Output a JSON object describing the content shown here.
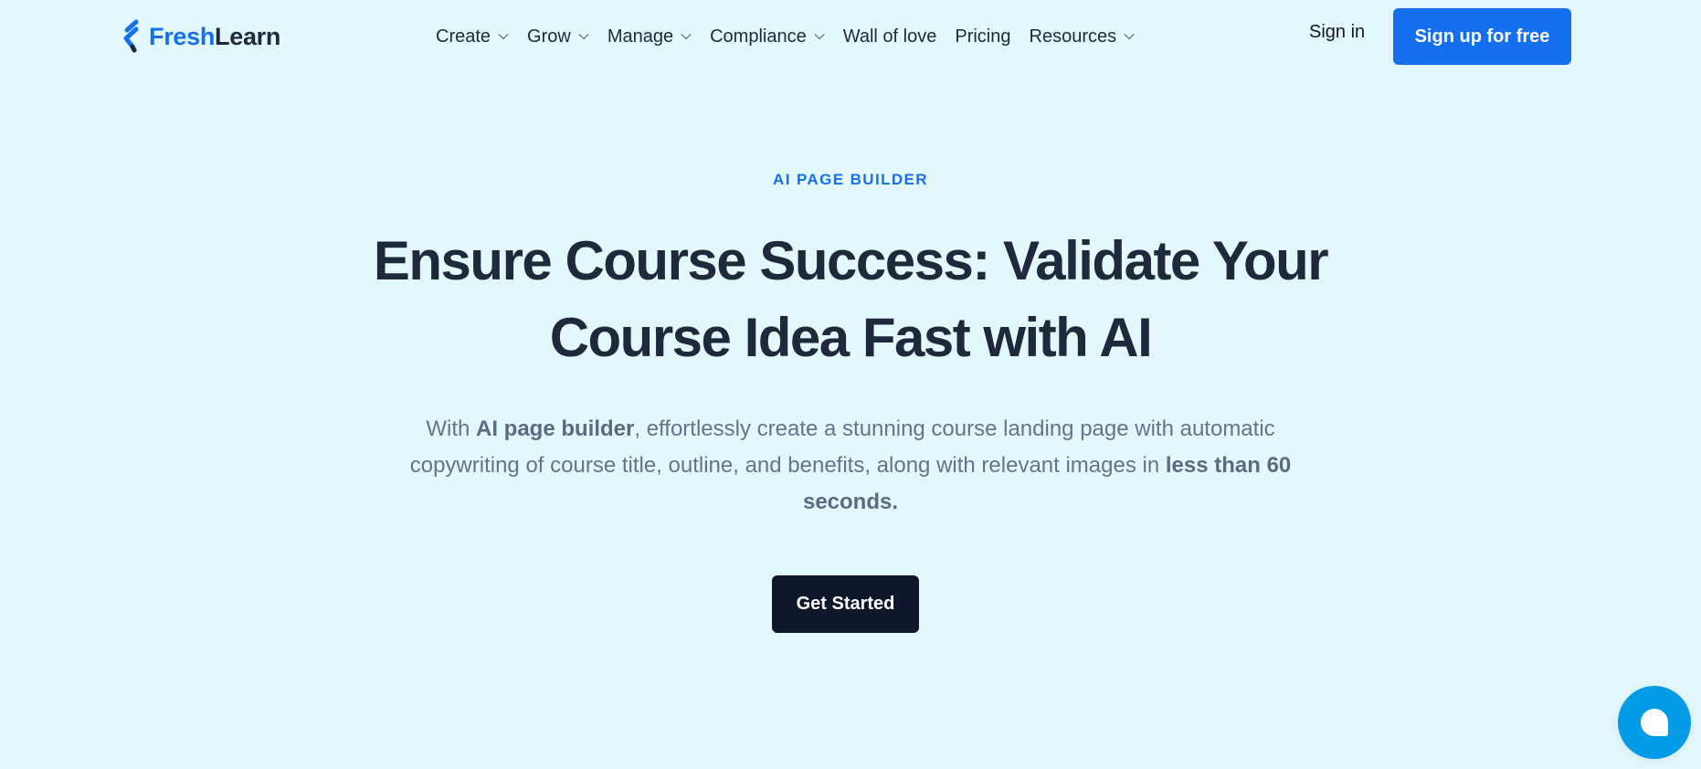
{
  "brand": {
    "name_part1": "Fresh",
    "name_part2": "Learn",
    "primary_color": "#1570ef",
    "dark_color": "#1e293b"
  },
  "nav": {
    "items": [
      {
        "label": "Create",
        "has_dropdown": true
      },
      {
        "label": "Grow",
        "has_dropdown": true
      },
      {
        "label": "Manage",
        "has_dropdown": true
      },
      {
        "label": "Compliance",
        "has_dropdown": true
      },
      {
        "label": "Wall of love",
        "has_dropdown": false
      },
      {
        "label": "Pricing",
        "has_dropdown": false
      },
      {
        "label": "Resources",
        "has_dropdown": true
      }
    ],
    "sign_in": "Sign in",
    "sign_up": "Sign up for free"
  },
  "hero": {
    "eyebrow": "AI PAGE BUILDER",
    "headline_line1": "Ensure Course Success: Validate Your",
    "headline_line2": "Course Idea Fast with AI",
    "subtitle": {
      "part1": "With ",
      "bold1": "AI page builder",
      "part2": ", effortlessly create a stunning course landing page with automatic copywriting of course title, outline, and benefits, along with relevant images in ",
      "bold2": "less than 60 seconds."
    },
    "cta_label": "Get Started"
  },
  "chat_widget": {
    "icon": "chat-bubble-icon",
    "color": "#039be5"
  }
}
